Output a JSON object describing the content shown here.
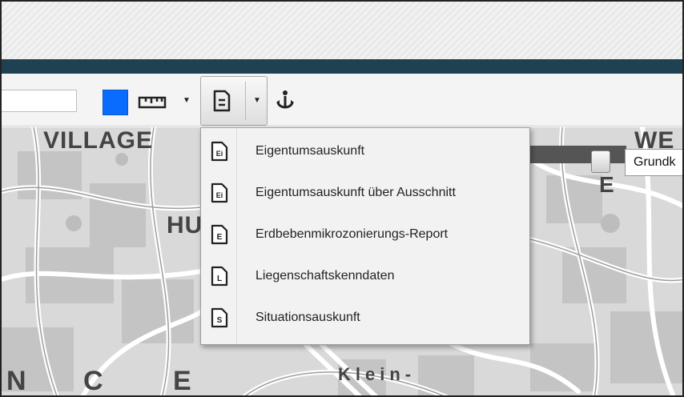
{
  "map": {
    "labels": [
      "VILLAGE",
      "WE",
      "E",
      "HU",
      "N",
      "C",
      "E",
      "Klein-"
    ]
  },
  "toolbar": {
    "color_accent": "#0a6cff",
    "icons": [
      "measure-icon",
      "report-icon",
      "anchor-icon"
    ]
  },
  "layer_switcher": {
    "selected": "Grundk"
  },
  "report_menu": {
    "items": [
      {
        "badge": "Ei",
        "label": "Eigentumsauskunft"
      },
      {
        "badge": "Ei",
        "label": "Eigentumsauskunft über Ausschnitt"
      },
      {
        "badge": "E",
        "label": "Erdbebenmikrozonierungs-Report"
      },
      {
        "badge": "L",
        "label": "Liegenschaftskenndaten"
      },
      {
        "badge": "S",
        "label": "Situationsauskunft"
      }
    ]
  }
}
